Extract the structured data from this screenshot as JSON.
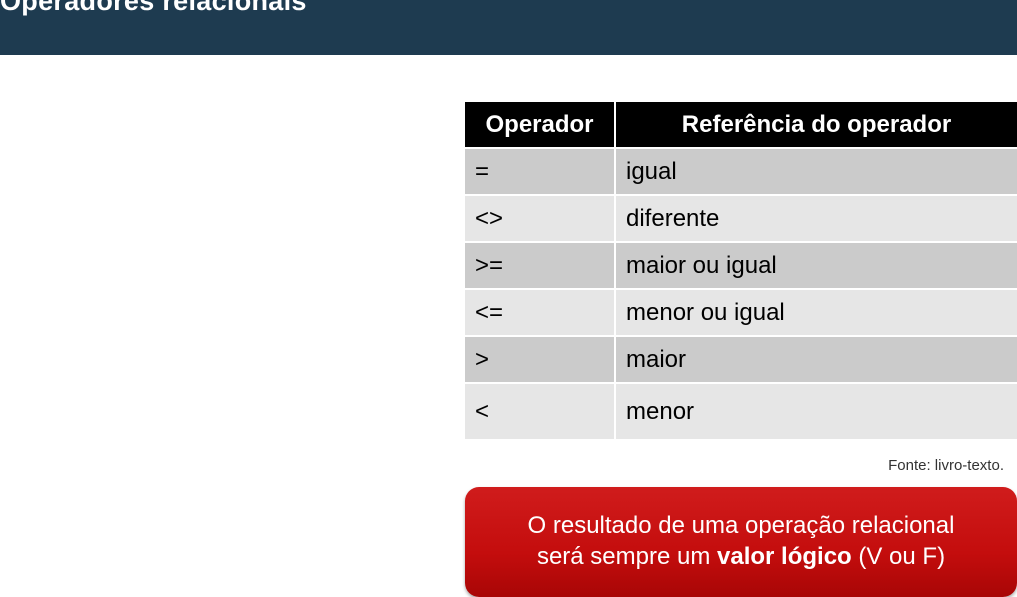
{
  "header": {
    "title": "Operadores relacionais"
  },
  "table": {
    "headers": [
      "Operador",
      "Referência do operador"
    ],
    "rows": [
      {
        "operator": "=",
        "reference": "igual"
      },
      {
        "operator": "<>",
        "reference": "diferente"
      },
      {
        "operator": ">=",
        "reference": "maior ou igual"
      },
      {
        "operator": "<=",
        "reference": "menor ou igual"
      },
      {
        "operator": ">",
        "reference": "maior"
      },
      {
        "operator": "<",
        "reference": "menor"
      }
    ]
  },
  "source": "Fonte: livro-texto.",
  "callout": {
    "line1": "O resultado de uma operação relacional",
    "line2_prefix": "será sempre um ",
    "line2_bold": "valor lógico",
    "line2_suffix": " (V ou F)"
  },
  "colors": {
    "title_bar": "#1e3b50",
    "table_header": "#000000",
    "row_dark": "#cbcbcb",
    "row_light": "#e6e6e6",
    "callout": "#c40d0d"
  }
}
